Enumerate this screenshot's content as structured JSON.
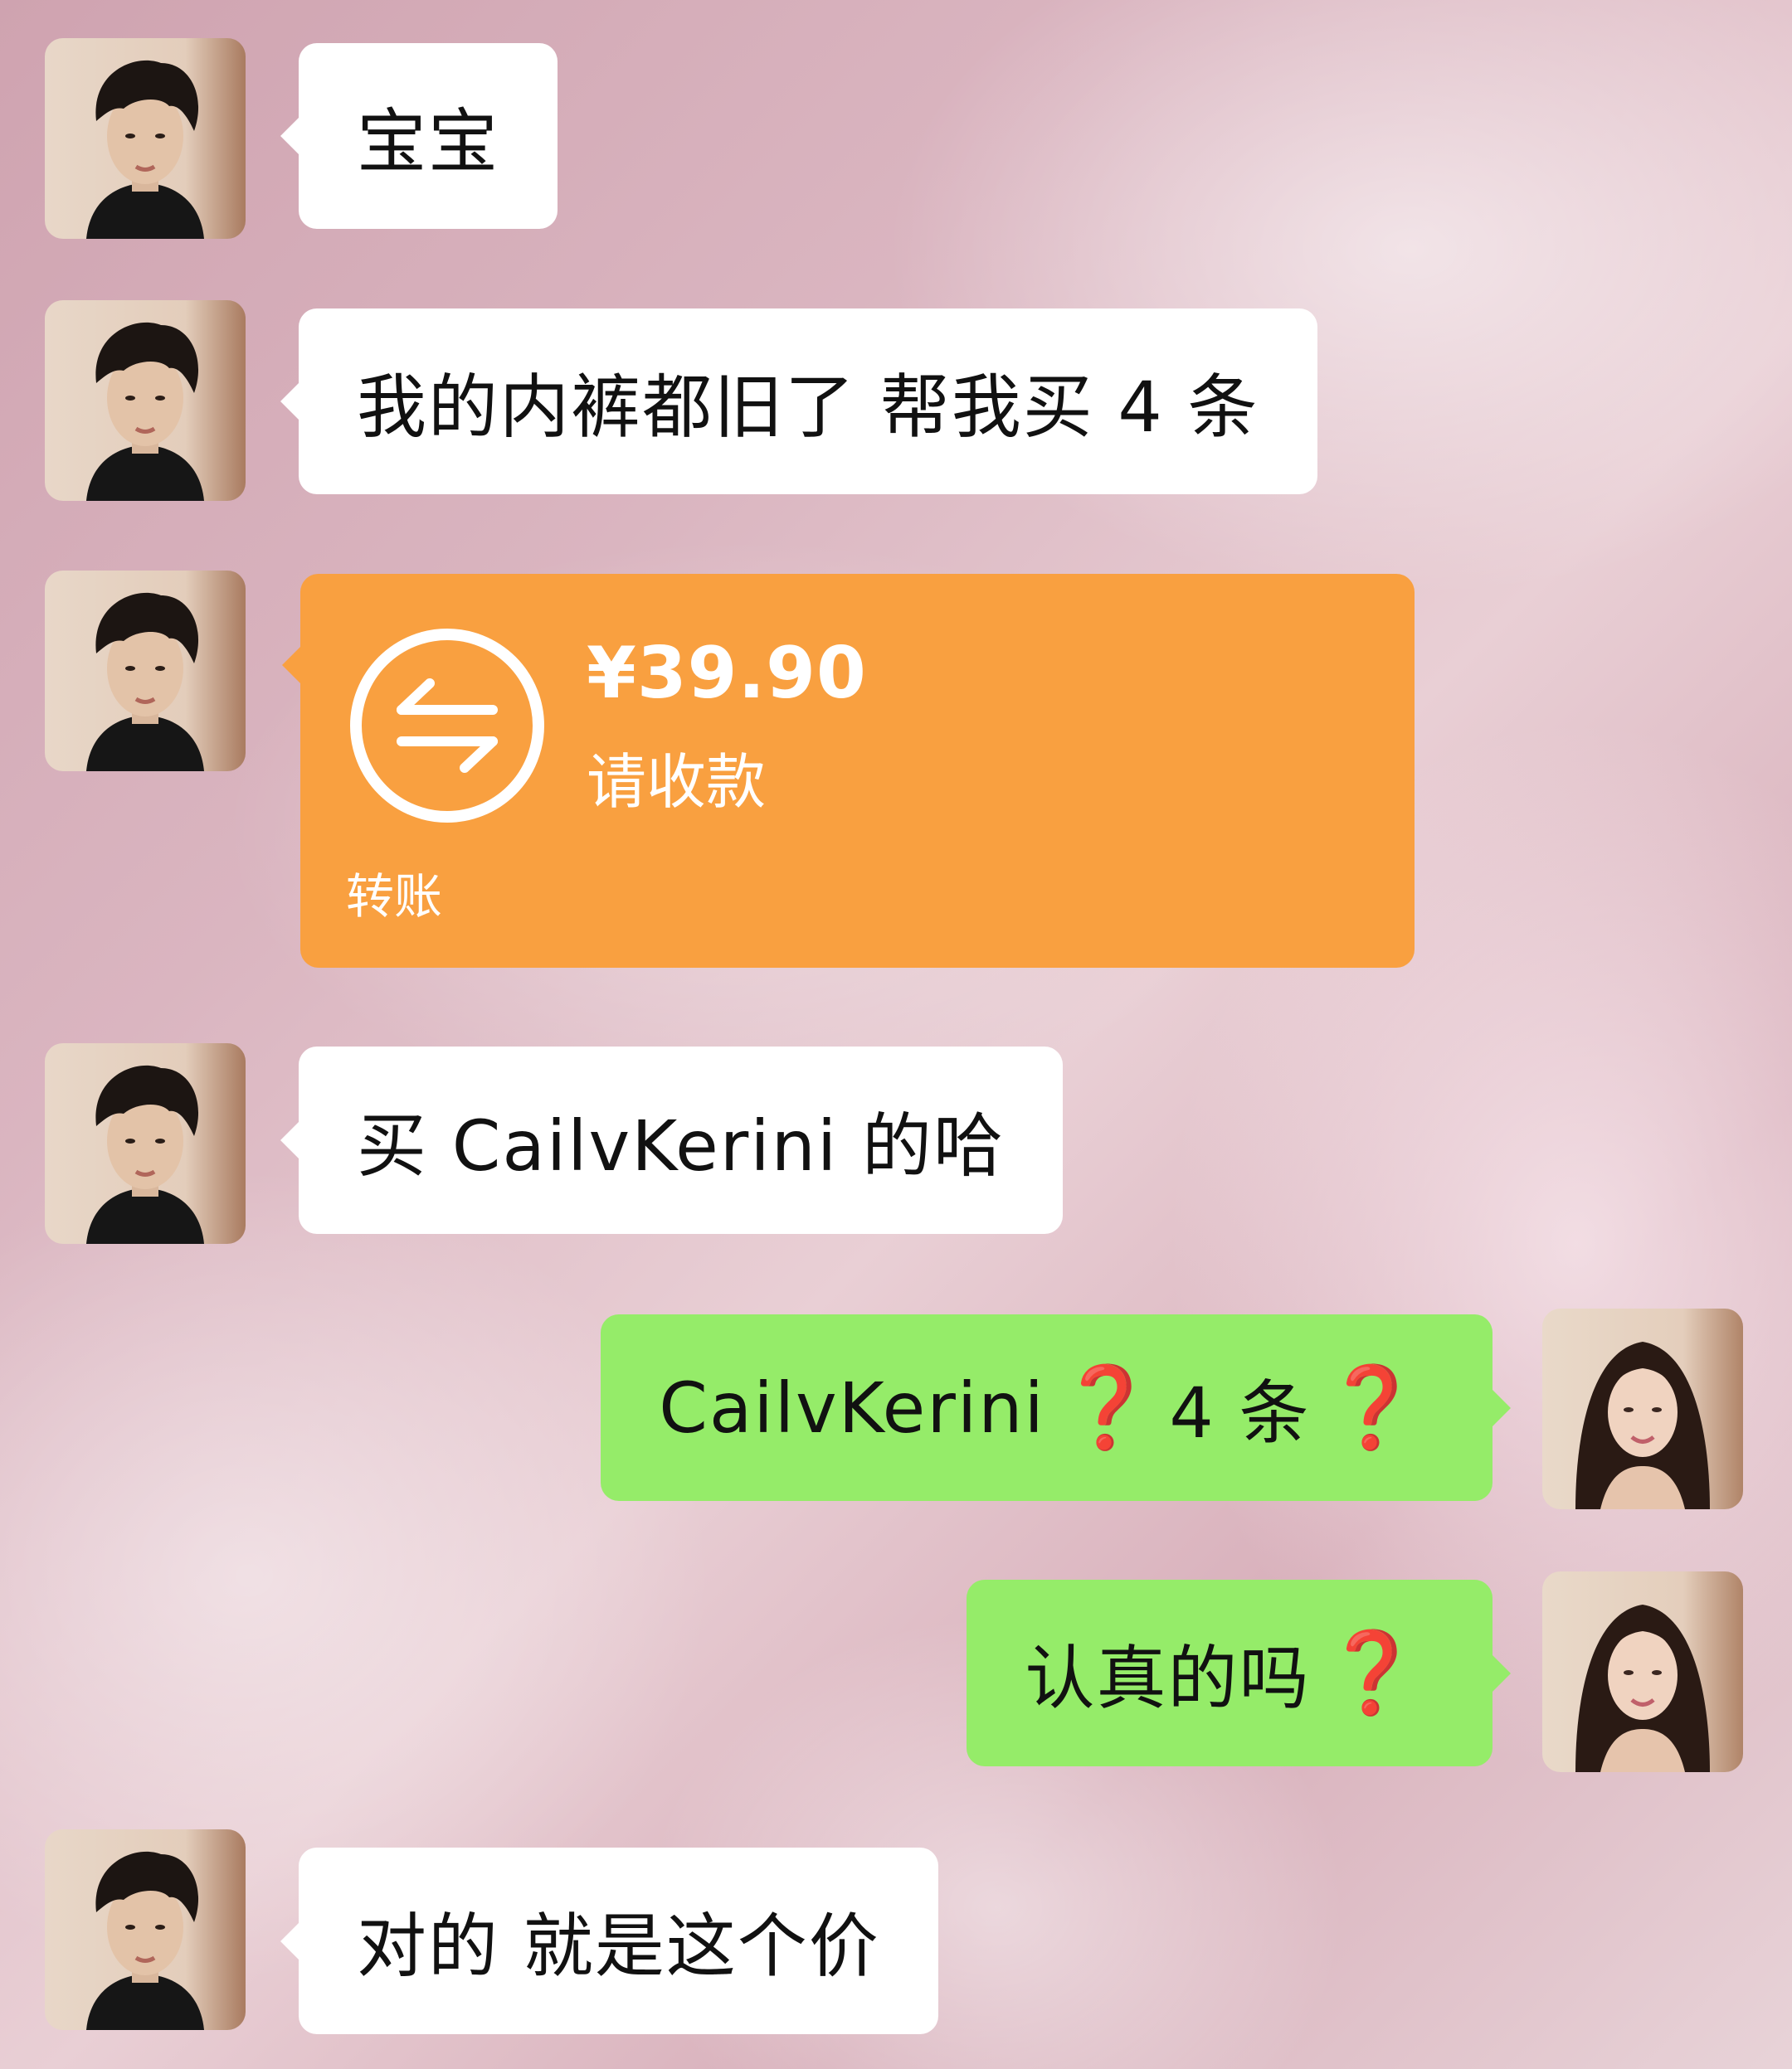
{
  "messages": [
    {
      "sender": "him",
      "type": "text",
      "text": "宝宝"
    },
    {
      "sender": "him",
      "type": "text",
      "text": "我的内裤都旧了 帮我买 4 条"
    },
    {
      "sender": "him",
      "type": "transfer",
      "amount": "¥39.90",
      "status": "请收款",
      "label": "转账"
    },
    {
      "sender": "him",
      "type": "text",
      "text": "买 CailvKerini 的哈"
    },
    {
      "sender": "her",
      "type": "text",
      "parts": [
        "CailvKerini",
        "❓",
        "4 条",
        "❓"
      ]
    },
    {
      "sender": "her",
      "type": "text",
      "parts": [
        "认真的吗",
        "❓"
      ]
    },
    {
      "sender": "him",
      "type": "text",
      "text": "对的 就是这个价"
    }
  ],
  "colors": {
    "received_bubble": "#ffffff",
    "sent_bubble": "#95ec69",
    "transfer_card": "#f9a040",
    "question_mark": "#e02020"
  },
  "icons": {
    "transfer": "transfer-arrows-icon",
    "question": "question-mark-icon"
  }
}
